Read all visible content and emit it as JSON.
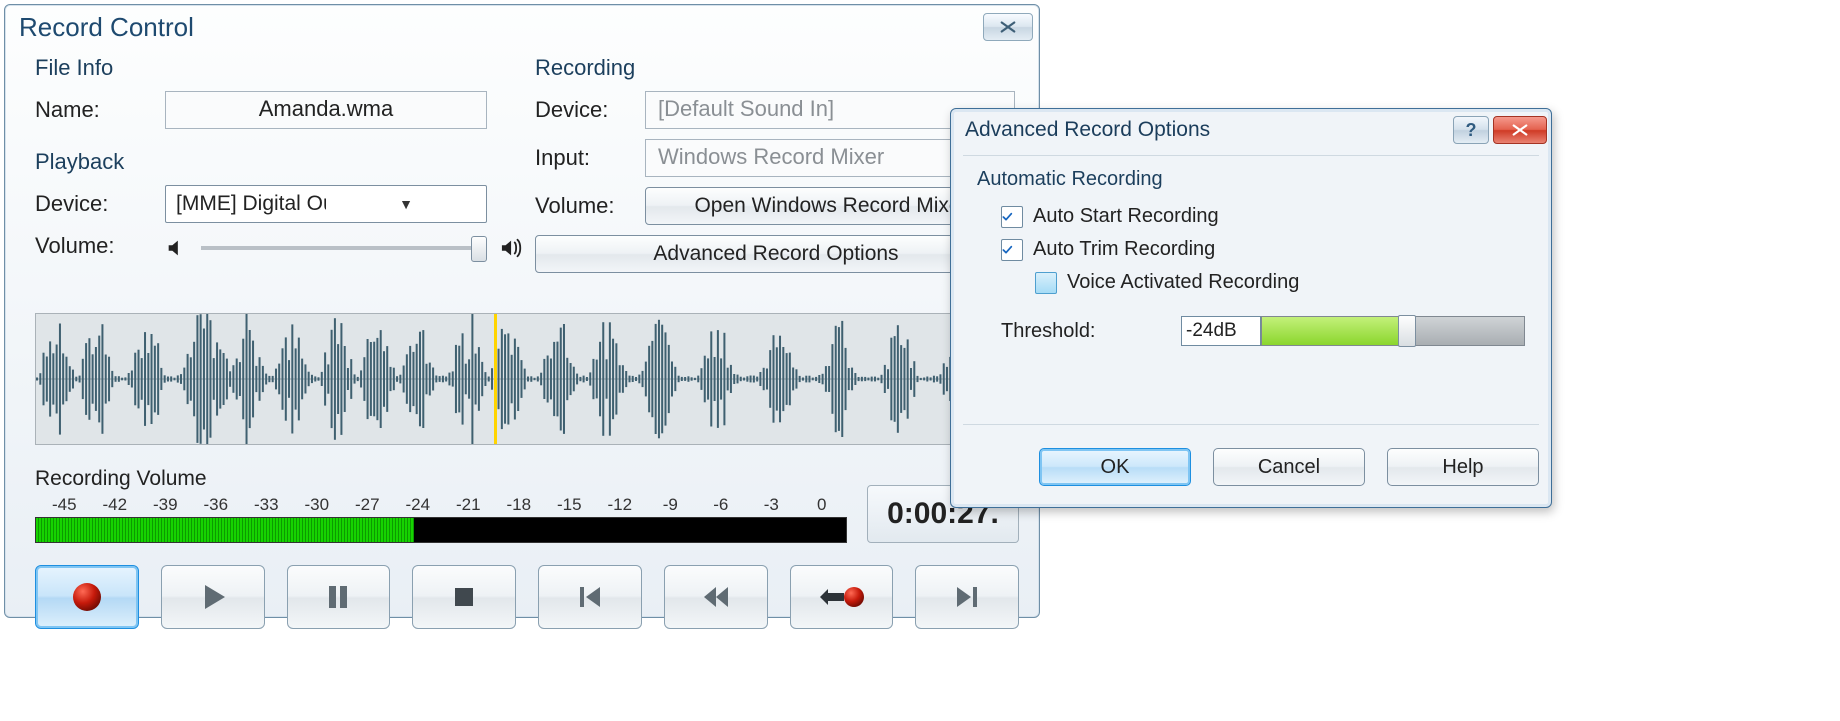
{
  "record_window": {
    "title": "Record Control",
    "file_info": {
      "group": "File Info",
      "name_label": "Name:",
      "name_value": "Amanda.wma"
    },
    "playback": {
      "group": "Playback",
      "device_label": "Device:",
      "device_value": "[MME] Digital Output Device",
      "volume_label": "Volume:",
      "volume_value": 100
    },
    "recording": {
      "group": "Recording",
      "device_label": "Device:",
      "device_value": "[Default Sound In]",
      "input_label": "Input:",
      "input_value": "Windows Record Mixer",
      "volume_label": "Volume:",
      "volume_button": "Open Windows Record Mixer",
      "advanced_button": "Advanced Record Options"
    },
    "meter": {
      "title": "Recording Volume",
      "ticks": [
        "-45",
        "-42",
        "-39",
        "-36",
        "-33",
        "-30",
        "-27",
        "-24",
        "-21",
        "-18",
        "-15",
        "-12",
        "-9",
        "-6",
        "-3",
        "0"
      ],
      "level_db": -24
    },
    "time": "0:00:27.",
    "transport": {
      "record": "record",
      "play": "play",
      "pause": "pause",
      "stop": "stop",
      "prev": "previous",
      "rewind": "rewind",
      "gotorec": "go-to-record",
      "next": "next"
    }
  },
  "adv_window": {
    "title": "Advanced Record Options",
    "group": "Automatic Recording",
    "auto_start": {
      "label": "Auto Start Recording",
      "checked": true
    },
    "auto_trim": {
      "label": "Auto Trim Recording",
      "checked": true
    },
    "voice_act": {
      "label": "Voice Activated Recording",
      "checked": false
    },
    "threshold_label": "Threshold:",
    "threshold_value": "-24dB",
    "threshold_fraction": 0.55,
    "buttons": {
      "ok": "OK",
      "cancel": "Cancel",
      "help": "Help"
    }
  }
}
